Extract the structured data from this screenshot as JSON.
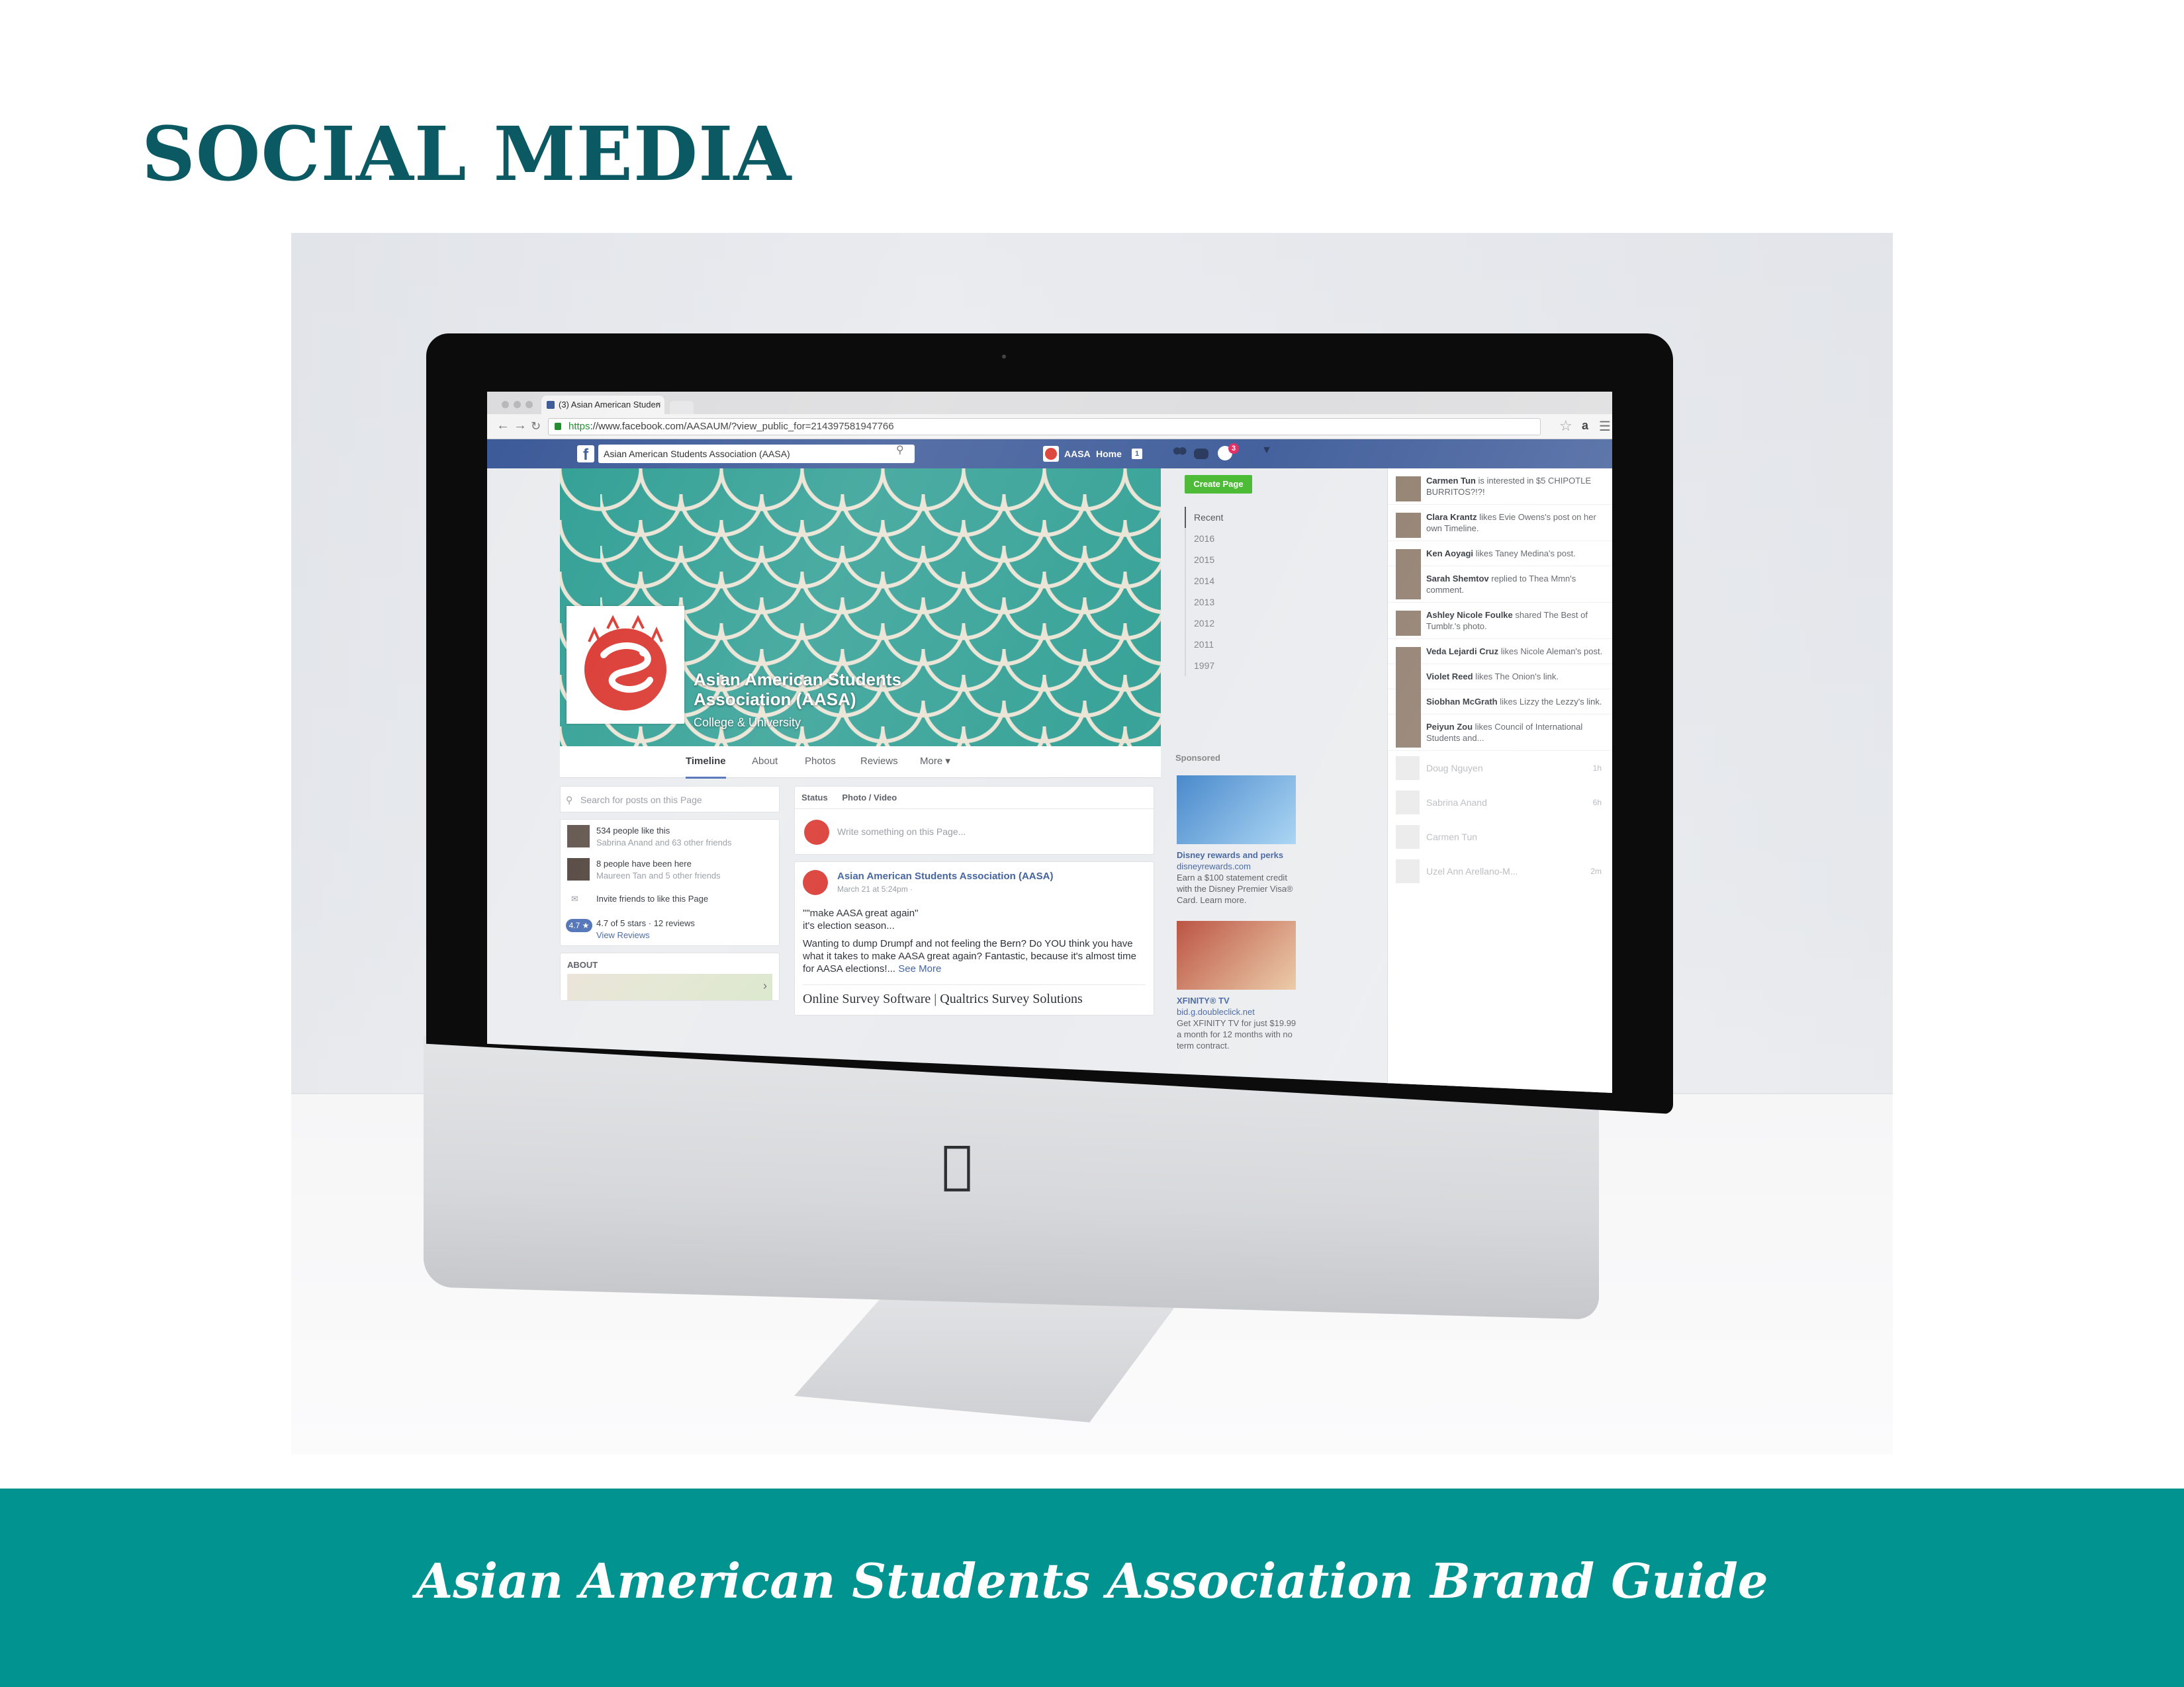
{
  "page": {
    "title": "SOCIAL MEDIA",
    "footer": "Asian American Students Association Brand Guide"
  },
  "colors": {
    "title": "#0b5a63",
    "footer_band": "#00938f",
    "facebook_blue": "#3b5998",
    "cover_teal": "#2e9e93",
    "logo_red": "#d9332b"
  },
  "browser": {
    "tab_title": "(3) Asian American Studen",
    "tab_close": "×",
    "url_scheme": "https",
    "url_rest": "://www.facebook.com/AASAUM/?view_public_for=214397581947766",
    "back_icon": "arrow-left-icon",
    "forward_icon": "arrow-right-icon",
    "reload_icon": "reload-icon"
  },
  "facebook": {
    "logo": "f",
    "search_value": "Asian American Students Association (AASA)",
    "user_short": "AASA",
    "home_label": "Home",
    "home_count": "1",
    "notif_count": "3",
    "page_name": "Asian American Students Association (AASA)",
    "page_category": "College & University",
    "tabs": [
      "Timeline",
      "About",
      "Photos",
      "Reviews",
      "More ▾"
    ],
    "create_page": "Create Page",
    "years": [
      "Recent",
      "2016",
      "2015",
      "2014",
      "2013",
      "2012",
      "2011",
      "1997"
    ],
    "left": {
      "search_placeholder": "Search for posts on this Page",
      "likes": "534 people like this",
      "likes_sub": "Sabrina Anand and 63 other friends",
      "visits": "8 people have been here",
      "visits_sub": "Maureen Tan and 5 other friends",
      "invite": "Invite friends to like this Page",
      "rating_badge": "4.7 ★",
      "rating": "4.7 of 5 stars · 12 reviews",
      "rating_sub": "View Reviews",
      "about": "ABOUT"
    },
    "composer": {
      "status": "Status",
      "photo_video": "Photo / Video",
      "placeholder": "Write something on this Page..."
    },
    "post": {
      "author": "Asian American Students Association (AASA)",
      "time": "March 21 at 5:24pm · ",
      "line1": "\"\"make AASA great again\"",
      "line2": "it's election season...",
      "body": "Wanting to dump Drumpf and not feeling the Bern? Do YOU think you have what it takes to make AASA great again? Fantastic, because it's almost time for AASA elections!...",
      "see_more": "See More",
      "link_title": "Online Survey Software | Qualtrics Survey Solutions"
    },
    "sponsored": {
      "label": "Sponsored",
      "ads": [
        {
          "title": "Disney rewards and perks",
          "domain": "disneyrewards.com",
          "text": "Earn a $100 statement credit with the Disney Premier Visa® Card. Learn more."
        },
        {
          "title": "XFINITY® TV",
          "domain": "bid.g.doubleclick.net",
          "text": "Get XFINITY TV for just $19.99 a month for 12 months with no term contract."
        }
      ]
    },
    "ticker": [
      {
        "name": "Carmen Tun",
        "text": " is interested in $5 CHIPOTLE BURRITOS?!?!"
      },
      {
        "name": "Clara Krantz",
        "text": " likes Evie Owens's post on her own Timeline."
      },
      {
        "name": "Ken Aoyagi",
        "text": " likes Taney Medina's post."
      },
      {
        "name": "Sarah Shemtov",
        "text": " replied to Thea Mmn's comment."
      },
      {
        "name": "Ashley Nicole Foulke",
        "text": " shared The Best of Tumblr.'s photo."
      },
      {
        "name": "Veda Lejardi Cruz",
        "text": " likes Nicole Aleman's post."
      },
      {
        "name": "Violet Reed",
        "text": " likes The Onion's link."
      },
      {
        "name": "Siobhan McGrath",
        "text": " likes Lizzy the Lezzy's link."
      },
      {
        "name": "Peiyun Zou",
        "text": " likes Council of International Students and..."
      }
    ],
    "chat": [
      {
        "name": "Doug Nguyen",
        "time": "1h"
      },
      {
        "name": "Sabrina Anand",
        "time": "6h"
      },
      {
        "name": "Carmen Tun",
        "time": ""
      },
      {
        "name": "Uzel Ann Arellano-M...",
        "time": "2m"
      }
    ]
  }
}
